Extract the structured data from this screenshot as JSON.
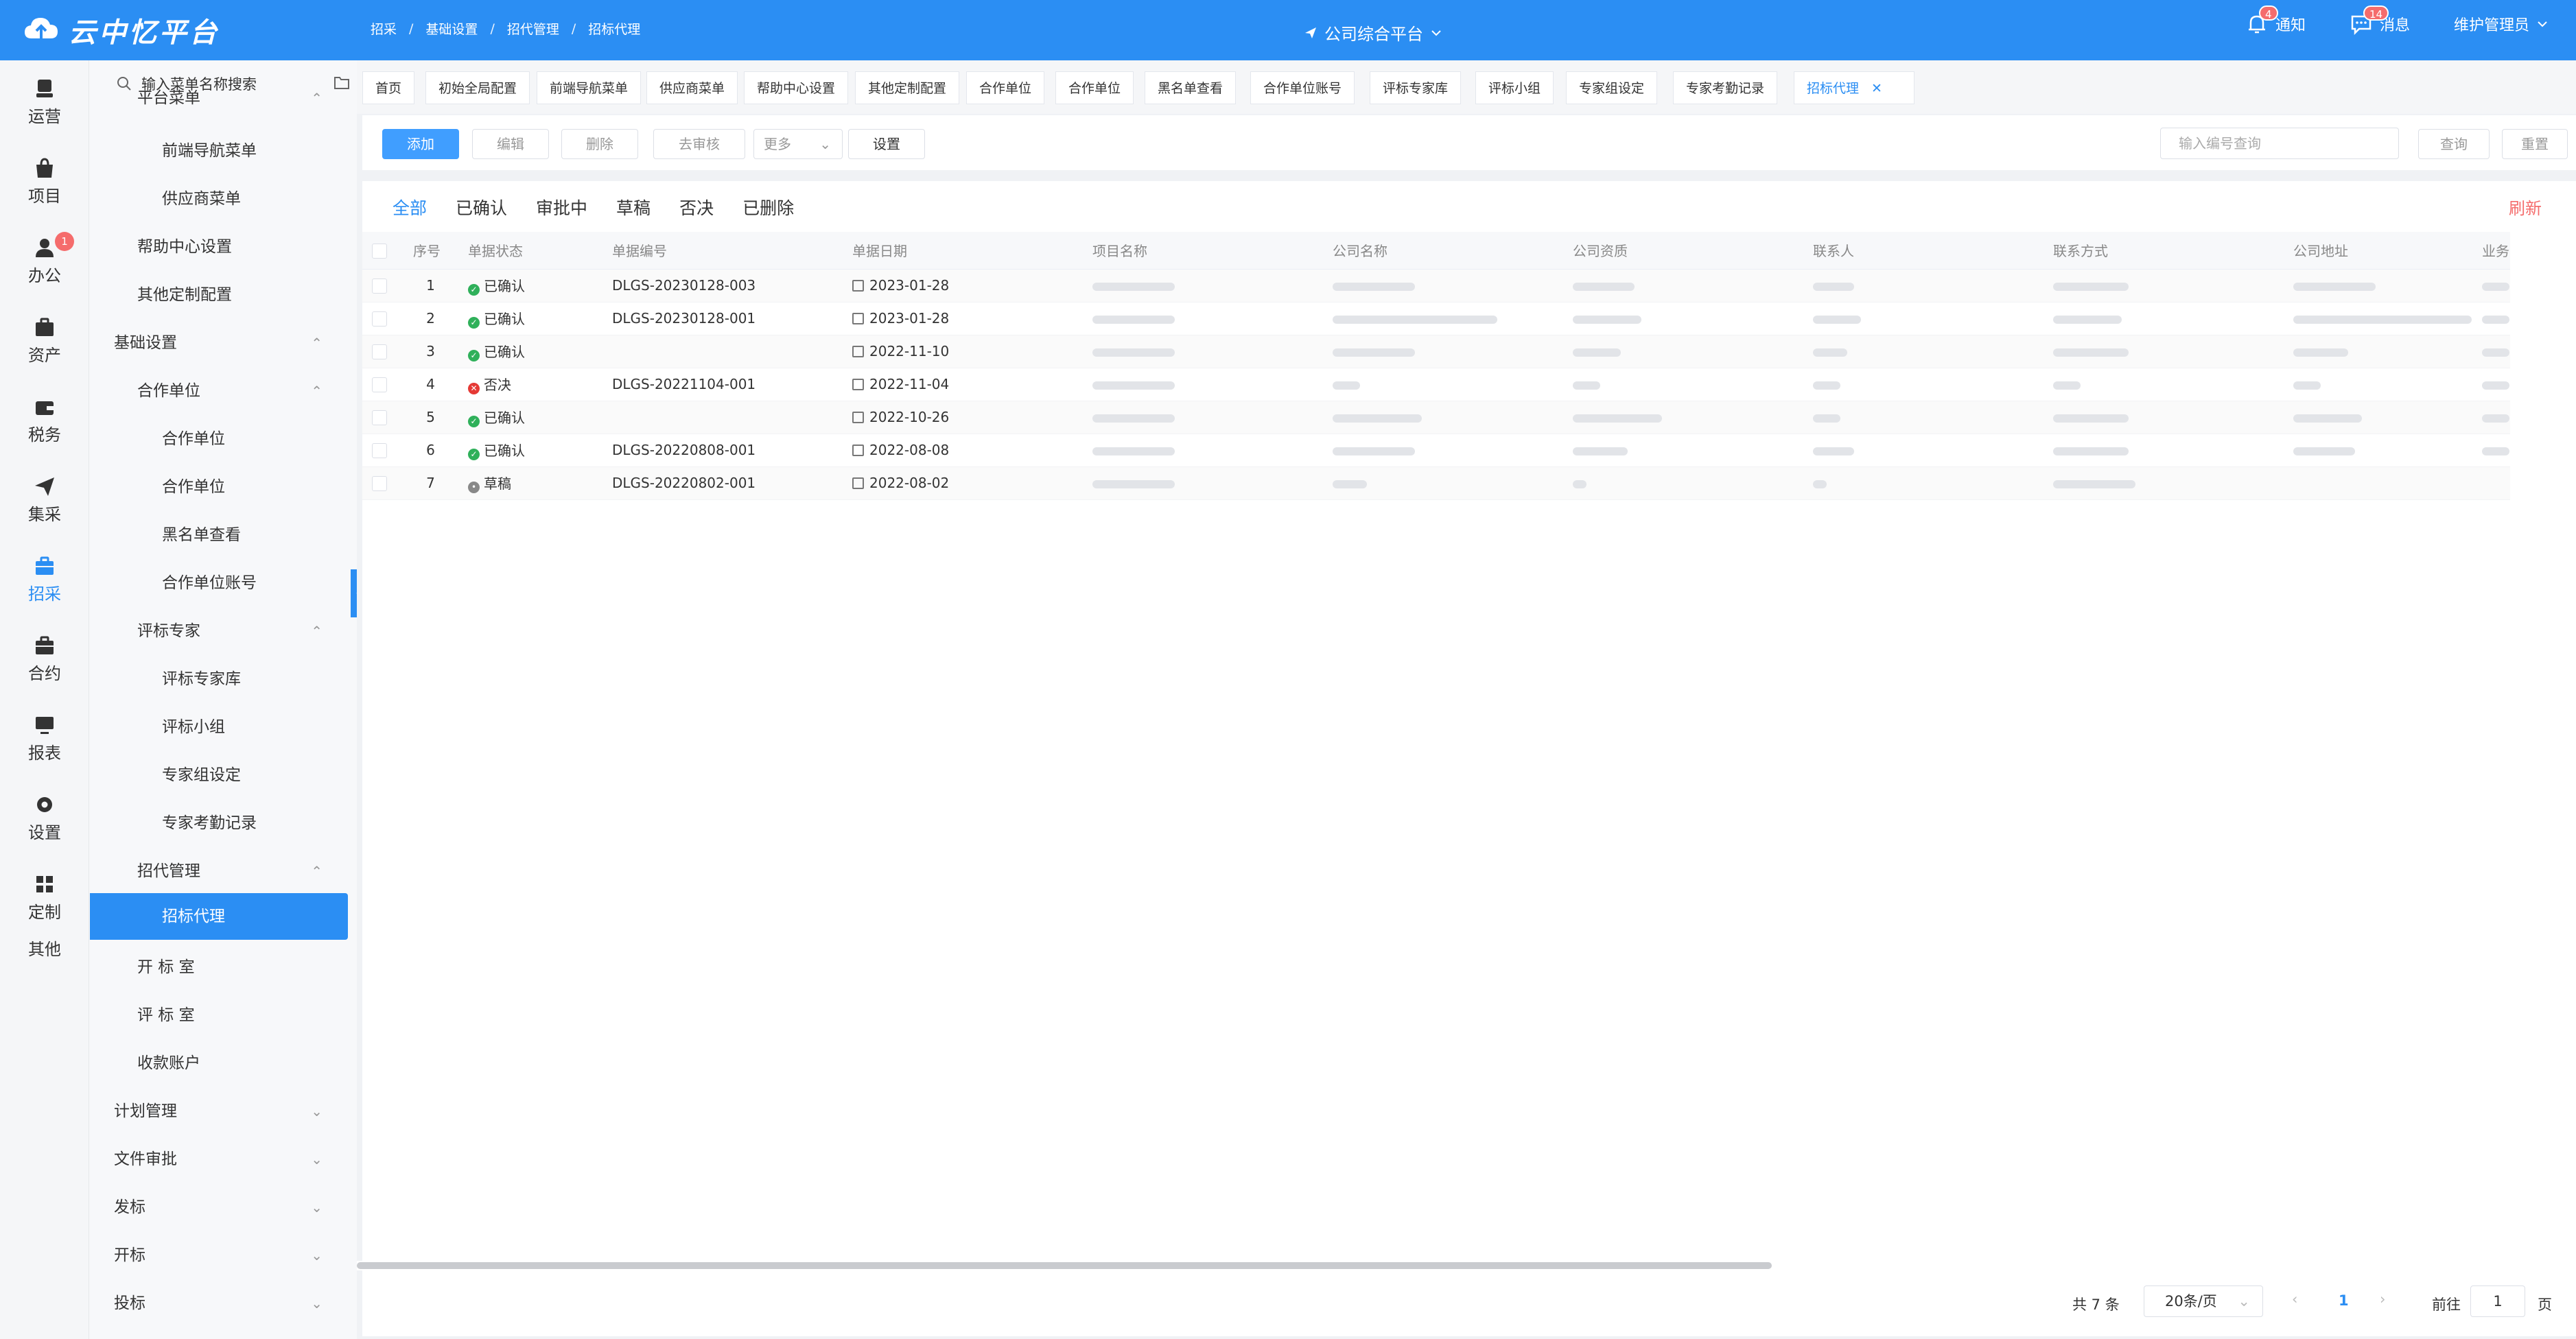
{
  "app": {
    "title": "云中忆平台"
  },
  "breadcrumb": [
    "招采",
    "基础设置",
    "招代管理",
    "招标代理"
  ],
  "platform": "公司综合平台",
  "header": {
    "notify_label": "通知",
    "notify_count": "4",
    "message_label": "消息",
    "message_count": "14",
    "user": "维护管理员"
  },
  "rail": [
    {
      "label": "运营"
    },
    {
      "label": "项目"
    },
    {
      "label": "办公",
      "badge": "1"
    },
    {
      "label": "资产"
    },
    {
      "label": "税务"
    },
    {
      "label": "集采"
    },
    {
      "label": "招采"
    },
    {
      "label": "合约"
    },
    {
      "label": "报表"
    },
    {
      "label": "设置"
    },
    {
      "label": "定制"
    },
    {
      "label": "其他"
    }
  ],
  "menu": {
    "search_placeholder": "输入菜单名称搜索",
    "items": [
      {
        "label": "平台菜单"
      },
      {
        "label": "前端导航菜单"
      },
      {
        "label": "供应商菜单"
      },
      {
        "label": "帮助中心设置"
      },
      {
        "label": "其他定制配置"
      },
      {
        "label": "基础设置"
      },
      {
        "label": "合作单位"
      },
      {
        "label": "合作单位"
      },
      {
        "label": "合作单位"
      },
      {
        "label": "黑名单查看"
      },
      {
        "label": "合作单位账号"
      },
      {
        "label": "评标专家"
      },
      {
        "label": "评标专家库"
      },
      {
        "label": "评标小组"
      },
      {
        "label": "专家组设定"
      },
      {
        "label": "专家考勤记录"
      },
      {
        "label": "招代管理"
      },
      {
        "label": "招标代理"
      },
      {
        "label": "开 标 室"
      },
      {
        "label": "评 标 室"
      },
      {
        "label": "收款账户"
      },
      {
        "label": "计划管理"
      },
      {
        "label": "文件审批"
      },
      {
        "label": "发标"
      },
      {
        "label": "开标"
      },
      {
        "label": "投标"
      }
    ]
  },
  "tabs": [
    "首页",
    "初始全局配置",
    "前端导航菜单",
    "供应商菜单",
    "帮助中心设置",
    "其他定制配置",
    "合作单位",
    "合作单位",
    "黑名单查看",
    "合作单位账号",
    "评标专家库",
    "评标小组",
    "专家组设定",
    "专家考勤记录",
    "招标代理"
  ],
  "toolbar": {
    "add": "添加",
    "edit": "编辑",
    "delete": "删除",
    "unreview": "去审核",
    "more": "更多",
    "settings": "设置",
    "query_placeholder": "输入编号查询",
    "query": "查询",
    "reset": "重置"
  },
  "status_tabs": [
    "全部",
    "已确认",
    "审批中",
    "草稿",
    "否决",
    "已删除"
  ],
  "refresh": "刷新",
  "table": {
    "columns": [
      "序号",
      "单据状态",
      "单据编号",
      "单据日期",
      "项目名称",
      "公司名称",
      "公司资质",
      "联系人",
      "联系方式",
      "公司地址",
      "业务"
    ],
    "rows": [
      {
        "no": "1",
        "status": "已确认",
        "state": "ok",
        "code": "DLGS-20230128-003",
        "date": "2023-01-28"
      },
      {
        "no": "2",
        "status": "已确认",
        "state": "ok",
        "code": "DLGS-20230128-001",
        "date": "2023-01-28"
      },
      {
        "no": "3",
        "status": "已确认",
        "state": "ok",
        "code": "",
        "date": "2022-11-10"
      },
      {
        "no": "4",
        "status": "否决",
        "state": "no",
        "code": "DLGS-20221104-001",
        "date": "2022-11-04"
      },
      {
        "no": "5",
        "status": "已确认",
        "state": "ok",
        "code": "",
        "date": "2022-10-26"
      },
      {
        "no": "6",
        "status": "已确认",
        "state": "ok",
        "code": "DLGS-20220808-001",
        "date": "2022-08-08"
      },
      {
        "no": "7",
        "status": "草稿",
        "state": "draft",
        "code": "DLGS-20220802-001",
        "date": "2022-08-02"
      }
    ]
  },
  "pager": {
    "total": "共 7 条",
    "size": "20条/页",
    "current": "1",
    "goto": "前往",
    "goto_value": "1",
    "page_unit": "页"
  },
  "colors": {
    "primary": "#2b8ef3",
    "danger": "#f56c6c",
    "success": "#2fb05a"
  }
}
